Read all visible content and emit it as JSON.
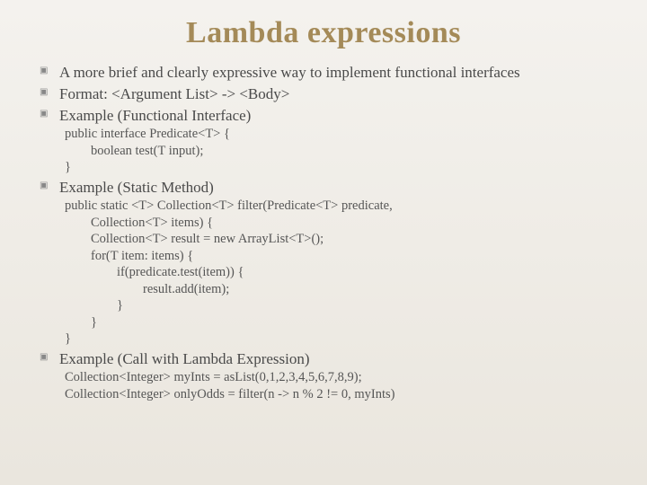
{
  "title": "Lambda expressions",
  "bullets": {
    "b1": {
      "lead": " A more brief and clearly expressive way to implement functional interfaces"
    },
    "b2": {
      "lead": " Format: <Argument List> -> <Body>"
    },
    "b3": {
      "lead": " Example (Functional Interface)",
      "code": "public interface Predicate<T> {\n        boolean test(T input);\n}"
    },
    "b4": {
      "lead": " Example (Static Method)",
      "code": "public static <T> Collection<T> filter(Predicate<T> predicate,\n        Collection<T> items) {\n        Collection<T> result = new ArrayList<T>();\n        for(T item: items) {\n                if(predicate.test(item)) {\n                        result.add(item);\n                }\n        }\n}"
    },
    "b5": {
      "lead": " Example (Call with Lambda Expression)",
      "code": "Collection<Integer> myInts = asList(0,1,2,3,4,5,6,7,8,9);\nCollection<Integer> onlyOdds = filter(n -> n % 2 != 0, myInts)"
    }
  }
}
